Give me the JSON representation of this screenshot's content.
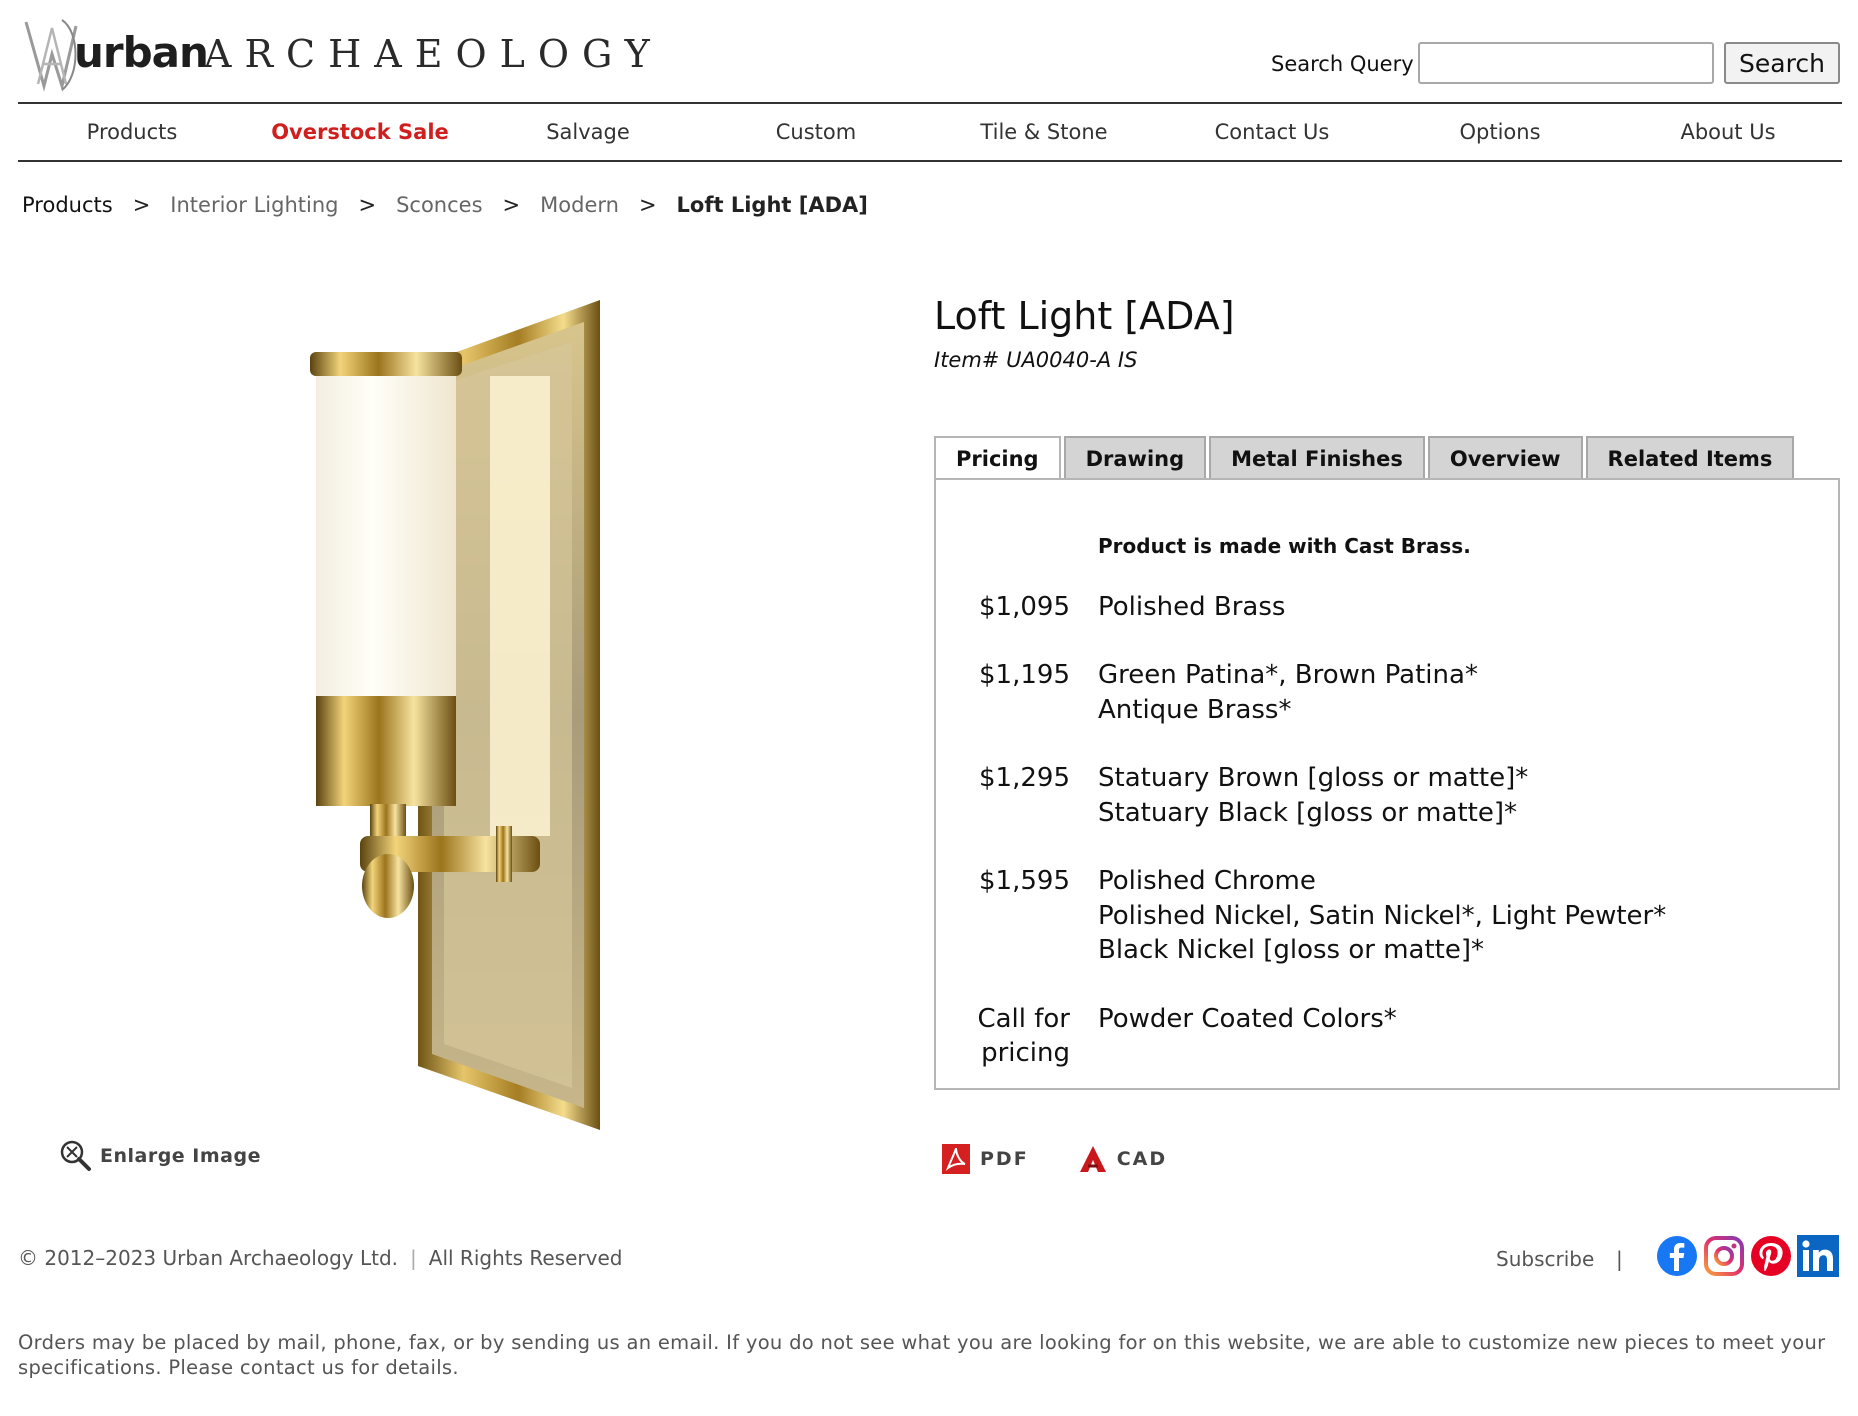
{
  "header": {
    "logo_text_urban": "urban",
    "logo_text_archaeology": "ARCHAEOLOGY",
    "search_label": "Search Query",
    "search_value": "",
    "search_button": "Search"
  },
  "nav": {
    "items": [
      {
        "label": "Products"
      },
      {
        "label": "Overstock Sale"
      },
      {
        "label": "Salvage"
      },
      {
        "label": "Custom"
      },
      {
        "label": "Tile & Stone"
      },
      {
        "label": "Contact Us"
      },
      {
        "label": "Options"
      },
      {
        "label": "About Us"
      }
    ]
  },
  "breadcrumb": {
    "items": [
      "Products",
      "Interior Lighting",
      "Sconces",
      "Modern"
    ],
    "separator": ">",
    "current": "Loft Light [ADA]"
  },
  "product": {
    "title": "Loft Light [ADA]",
    "item_number": "Item# UA0040-A IS",
    "enlarge_label": "Enlarge Image"
  },
  "tabs": [
    "Pricing",
    "Drawing",
    "Metal Finishes",
    "Overview",
    "Related Items"
  ],
  "pricing": {
    "note": "Product is made with Cast Brass.",
    "rows": [
      {
        "price": "$1,095",
        "finishes": [
          "Polished Brass"
        ]
      },
      {
        "price": "$1,195",
        "finishes": [
          "Green Patina*, Brown Patina*",
          "Antique Brass*"
        ]
      },
      {
        "price": "$1,295",
        "finishes": [
          "Statuary Brown [gloss or matte]*",
          "Statuary Black [gloss or matte]*"
        ]
      },
      {
        "price": "$1,595",
        "finishes": [
          "Polished Chrome",
          "Polished Nickel, Satin Nickel*, Light Pewter*",
          "Black Nickel [gloss or matte]*"
        ]
      },
      {
        "price_line1": "Call for",
        "price_line2": "pricing",
        "finishes": [
          "Powder Coated Colors*"
        ]
      }
    ]
  },
  "downloads": {
    "pdf": "PDF",
    "cad": "CAD"
  },
  "footer": {
    "copyright": "© 2012–2023 Urban Archaeology Ltd.",
    "rights": "All Rights Reserved",
    "subscribe": "Subscribe",
    "separator": "|",
    "disclaimer": "Orders may be placed by mail, phone, fax, or by sending us an email. If you do not see what you are looking for on this website, we are able to customize new pieces to meet your specifications. Please contact us for details."
  },
  "colors": {
    "sale": "#d01f1f",
    "brass": "#c99a2e",
    "facebook": "#1877f2",
    "pinterest": "#e60023",
    "linkedin": "#0a66c2"
  }
}
